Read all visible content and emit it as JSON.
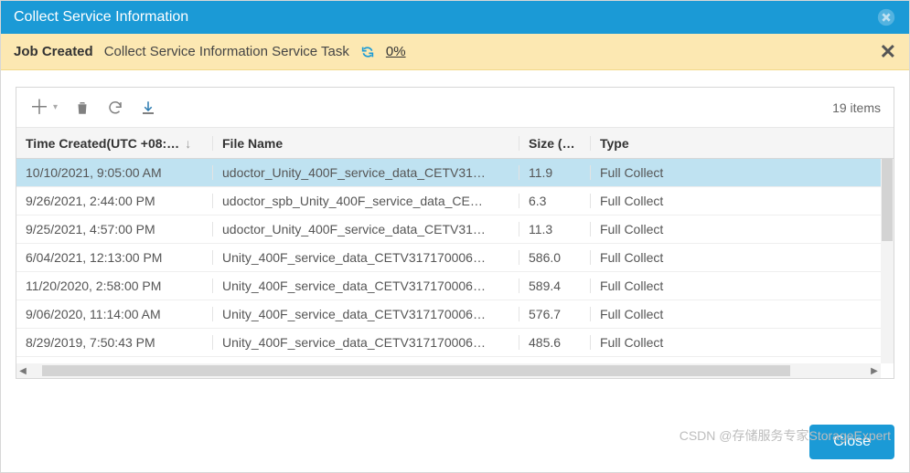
{
  "dialog": {
    "title": "Collect Service Information"
  },
  "job": {
    "label": "Job Created",
    "task": "Collect Service Information Service Task",
    "progress": "0%"
  },
  "toolbar": {
    "items_count": "19 items"
  },
  "columns": {
    "time": "Time Created(UTC +08:…",
    "file": "File Name",
    "size": "Size (M…",
    "type": "Type"
  },
  "rows": [
    {
      "time": "10/10/2021, 9:05:00 AM",
      "file": "udoctor_Unity_400F_service_data_CETV31…",
      "size": "11.9",
      "type": "Full Collect",
      "selected": true
    },
    {
      "time": "9/26/2021, 2:44:00 PM",
      "file": "udoctor_spb_Unity_400F_service_data_CE…",
      "size": "6.3",
      "type": "Full Collect"
    },
    {
      "time": "9/25/2021, 4:57:00 PM",
      "file": "udoctor_Unity_400F_service_data_CETV31…",
      "size": "11.3",
      "type": "Full Collect"
    },
    {
      "time": "6/04/2021, 12:13:00 PM",
      "file": "Unity_400F_service_data_CETV317170006…",
      "size": "586.0",
      "type": "Full Collect"
    },
    {
      "time": "11/20/2020, 2:58:00 PM",
      "file": "Unity_400F_service_data_CETV317170006…",
      "size": "589.4",
      "type": "Full Collect"
    },
    {
      "time": "9/06/2020, 11:14:00 AM",
      "file": "Unity_400F_service_data_CETV317170006…",
      "size": "576.7",
      "type": "Full Collect"
    },
    {
      "time": "8/29/2019, 7:50:43 PM",
      "file": "Unity_400F_service_data_CETV317170006…",
      "size": "485.6",
      "type": "Full Collect"
    }
  ],
  "footer": {
    "close": "Close"
  },
  "watermark": "CSDN @存储服务专家StorageExpert"
}
